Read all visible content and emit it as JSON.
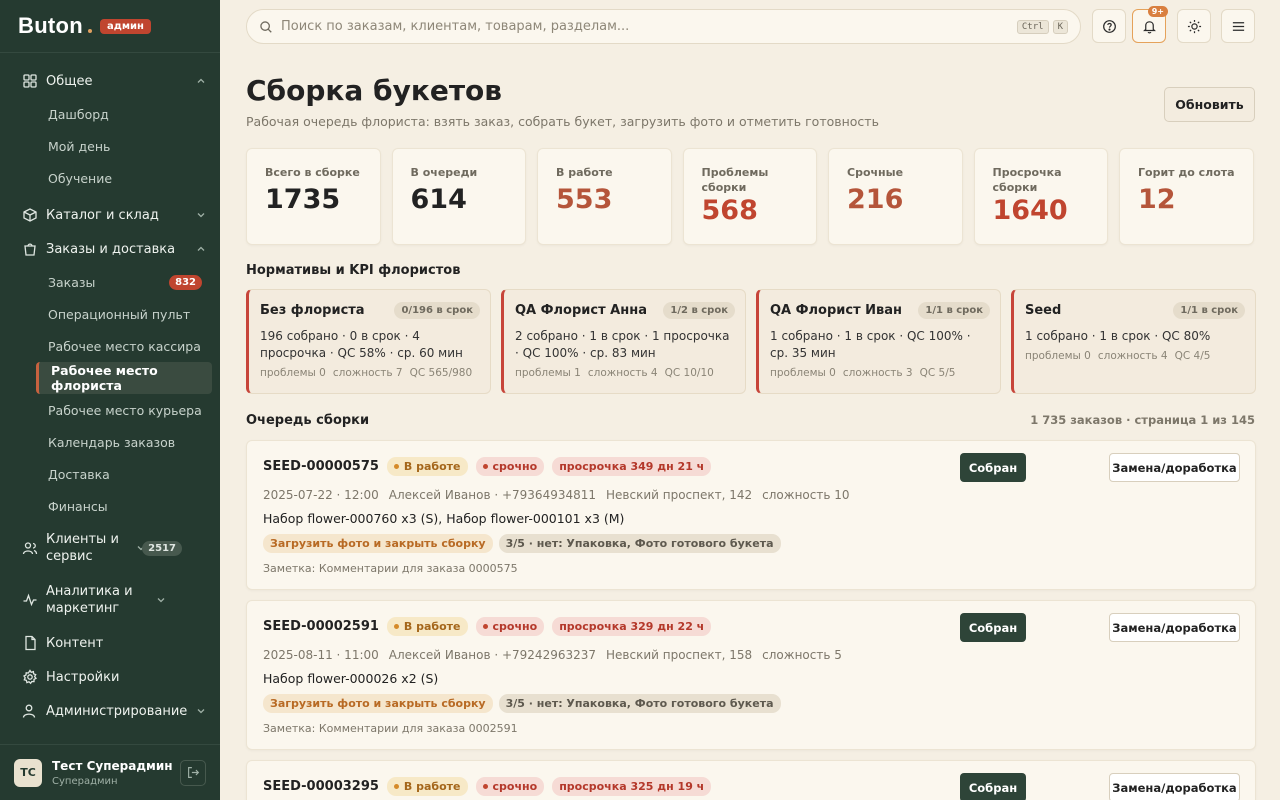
{
  "brand": {
    "name": "Buton",
    "badge": "админ"
  },
  "sidebar": {
    "sections": [
      {
        "label": "Общее",
        "icon": "grid-icon"
      },
      {
        "label": "Каталог и склад",
        "icon": "box-icon"
      },
      {
        "label": "Заказы и доставка",
        "icon": "cart-icon"
      },
      {
        "label": "Клиенты и сервис",
        "icon": "users-icon",
        "count": "2517"
      },
      {
        "label": "Аналитика и маркетинг",
        "icon": "chart-icon"
      },
      {
        "label": "Контент",
        "icon": "document-icon"
      },
      {
        "label": "Настройки",
        "icon": "gear-icon"
      },
      {
        "label": "Администрирование",
        "icon": "admin-icon"
      }
    ],
    "general_items": [
      "Дашборд",
      "Мой день",
      "Обучение"
    ],
    "orders_items": [
      {
        "label": "Заказы",
        "count": "832"
      },
      {
        "label": "Операционный пульт"
      },
      {
        "label": "Рабочее место кассира"
      },
      {
        "label": "Рабочее место флориста"
      },
      {
        "label": "Рабочее место курьера"
      },
      {
        "label": "Календарь заказов"
      },
      {
        "label": "Доставка"
      },
      {
        "label": "Финансы"
      }
    ]
  },
  "user": {
    "initials": "ТС",
    "name": "Тест Суперадмин",
    "role": "Суперадмин"
  },
  "search": {
    "placeholder": "Поиск по заказам, клиентам, товарам, разделам...",
    "kbd1": "Ctrl",
    "kbd2": "K"
  },
  "notifications": {
    "count": "9+"
  },
  "page": {
    "title": "Сборка букетов",
    "subtitle": "Рабочая очередь флориста: взять заказ, собрать букет, загрузить фото и отметить готовность",
    "refresh_label": "Обновить"
  },
  "stats": [
    {
      "label": "Всего в сборке",
      "value": "1735"
    },
    {
      "label": "В очереди",
      "value": "614"
    },
    {
      "label": "В работе",
      "value": "553"
    },
    {
      "label": "Проблемы сборки",
      "value": "568"
    },
    {
      "label": "Срочные",
      "value": "216"
    },
    {
      "label": "Просрочка сборки",
      "value": "1640"
    },
    {
      "label": "Горит до слота",
      "value": "12"
    }
  ],
  "kpi_title": "Нормативы и KPI флористов",
  "kpis": [
    {
      "name": "Без флориста",
      "pill": "0/196 в срок",
      "main": "196 собрано · 0 в срок · 4 просрочка · QC 58% · ср. 60 мин",
      "problems": "проблемы 0",
      "complexity": "сложность 7",
      "qc": "QC 565/980"
    },
    {
      "name": "QA Флорист Анна",
      "pill": "1/2 в срок",
      "main": "2 собрано · 1 в срок · 1 просрочка · QC 100% · ср. 83 мин",
      "problems": "проблемы 1",
      "complexity": "сложность 4",
      "qc": "QC 10/10"
    },
    {
      "name": "QA Флорист Иван",
      "pill": "1/1 в срок",
      "main": "1 собрано · 1 в срок · QC 100% · ср. 35 мин",
      "problems": "проблемы 0",
      "complexity": "сложность 3",
      "qc": "QC 5/5"
    },
    {
      "name": "Seed",
      "pill": "1/1 в срок",
      "main": "1 собрано · 1 в срок · QC 80%",
      "problems": "проблемы 0",
      "complexity": "сложность 4",
      "qc": "QC 4/5"
    }
  ],
  "queue": {
    "title": "Очередь сборки",
    "pager": "1 735 заказов · страница 1 из 145",
    "done_label": "Собран",
    "redo_label": "Замена/доработка",
    "orders": [
      {
        "id": "SEED-00000575",
        "status": "В работе",
        "urgent": "срочно",
        "late": "просрочка 349 дн 21 ч",
        "date": "2025-07-22 · 12:00",
        "client": "Алексей Иванов · +79364934811",
        "address": "Невский проспект, 142",
        "complexity": "сложность 10",
        "items": "Набор flower-000760 x3 (S), Набор flower-000101 x3 (M)",
        "task": "Загрузить фото и закрыть сборку",
        "check": "3/5 · нет: Упаковка, Фото готового букета",
        "note": "Заметка: Комментарии для заказа 0000575"
      },
      {
        "id": "SEED-00002591",
        "status": "В работе",
        "urgent": "срочно",
        "late": "просрочка 329 дн 22 ч",
        "date": "2025-08-11 · 11:00",
        "client": "Алексей Иванов · +79242963237",
        "address": "Невский проспект, 158",
        "complexity": "сложность 5",
        "items": "Набор flower-000026 x2 (S)",
        "task": "Загрузить фото и закрыть сборку",
        "check": "3/5 · нет: Упаковка, Фото готового букета",
        "note": "Заметка: Комментарии для заказа 0002591"
      },
      {
        "id": "SEED-00003295",
        "status": "В работе",
        "urgent": "срочно",
        "late": "просрочка 325 дн 19 ч"
      }
    ]
  }
}
